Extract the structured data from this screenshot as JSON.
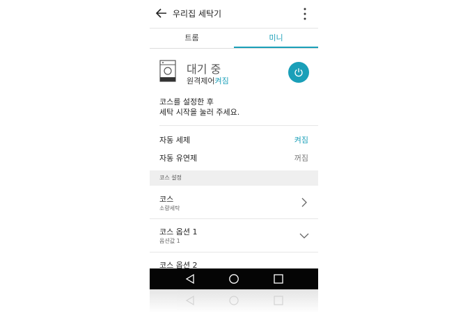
{
  "app_bar": {
    "title": "우리집 세탁기"
  },
  "tabs": [
    {
      "label": "트롬"
    },
    {
      "label": "미니"
    }
  ],
  "status": {
    "title": "대기 중",
    "remote_label": "원격제어",
    "remote_value": "켜짐"
  },
  "guide": {
    "line1": "코스를 설정한 후",
    "line2": "세탁 시작을 눌러 주세요."
  },
  "settings": [
    {
      "label": "자동 세제",
      "value": "켜짐"
    },
    {
      "label": "자동 유연제",
      "value": "꺼짐"
    }
  ],
  "section": {
    "title": "코스 설정"
  },
  "course_rows": [
    {
      "title": "코스",
      "subtitle": "소량세탁"
    },
    {
      "title": "코스 옵션 1",
      "subtitle": "옵션값 1"
    },
    {
      "title": "코스 옵션 2"
    }
  ],
  "colors": {
    "accent": "#1a9fb8",
    "navbar": "#050505",
    "section_bg": "#efefef"
  },
  "icons": [
    "back-arrow-icon",
    "more-vert-icon",
    "washer-icon",
    "power-icon",
    "chevron-right-icon",
    "chevron-down-icon",
    "nav-back-icon",
    "nav-home-icon",
    "nav-recent-icon"
  ]
}
